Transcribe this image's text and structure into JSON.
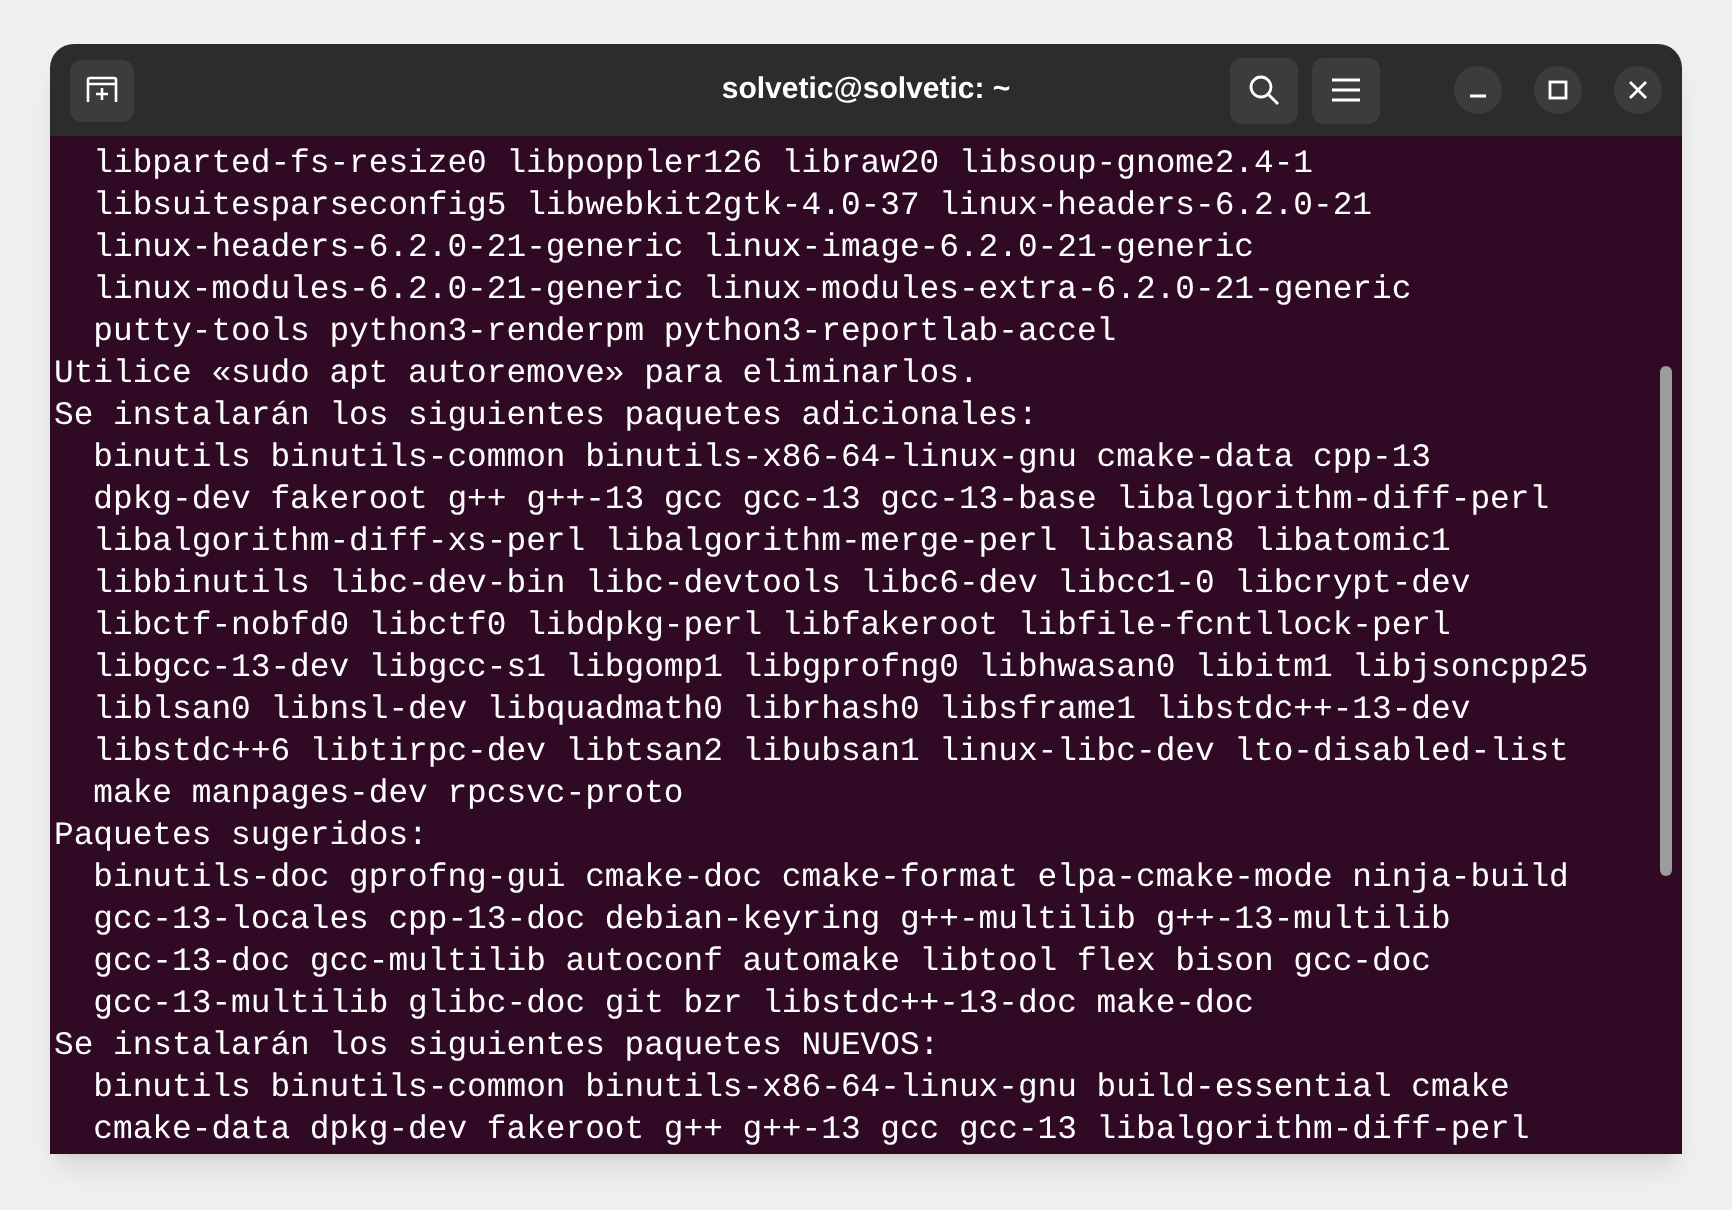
{
  "window": {
    "title": "solvetic@solvetic: ~"
  },
  "terminal": {
    "lines": [
      "  libparted-fs-resize0 libpoppler126 libraw20 libsoup-gnome2.4-1",
      "  libsuitesparseconfig5 libwebkit2gtk-4.0-37 linux-headers-6.2.0-21",
      "  linux-headers-6.2.0-21-generic linux-image-6.2.0-21-generic",
      "  linux-modules-6.2.0-21-generic linux-modules-extra-6.2.0-21-generic",
      "  putty-tools python3-renderpm python3-reportlab-accel",
      "Utilice «sudo apt autoremove» para eliminarlos.",
      "Se instalarán los siguientes paquetes adicionales:",
      "  binutils binutils-common binutils-x86-64-linux-gnu cmake-data cpp-13",
      "  dpkg-dev fakeroot g++ g++-13 gcc gcc-13 gcc-13-base libalgorithm-diff-perl",
      "  libalgorithm-diff-xs-perl libalgorithm-merge-perl libasan8 libatomic1",
      "  libbinutils libc-dev-bin libc-devtools libc6-dev libcc1-0 libcrypt-dev",
      "  libctf-nobfd0 libctf0 libdpkg-perl libfakeroot libfile-fcntllock-perl",
      "  libgcc-13-dev libgcc-s1 libgomp1 libgprofng0 libhwasan0 libitm1 libjsoncpp25",
      "  liblsan0 libnsl-dev libquadmath0 librhash0 libsframe1 libstdc++-13-dev",
      "  libstdc++6 libtirpc-dev libtsan2 libubsan1 linux-libc-dev lto-disabled-list",
      "  make manpages-dev rpcsvc-proto",
      "Paquetes sugeridos:",
      "  binutils-doc gprofng-gui cmake-doc cmake-format elpa-cmake-mode ninja-build",
      "  gcc-13-locales cpp-13-doc debian-keyring g++-multilib g++-13-multilib",
      "  gcc-13-doc gcc-multilib autoconf automake libtool flex bison gcc-doc",
      "  gcc-13-multilib glibc-doc git bzr libstdc++-13-doc make-doc",
      "Se instalarán los siguientes paquetes NUEVOS:",
      "  binutils binutils-common binutils-x86-64-linux-gnu build-essential cmake",
      "  cmake-data dpkg-dev fakeroot g++ g++-13 gcc gcc-13 libalgorithm-diff-perl"
    ]
  }
}
